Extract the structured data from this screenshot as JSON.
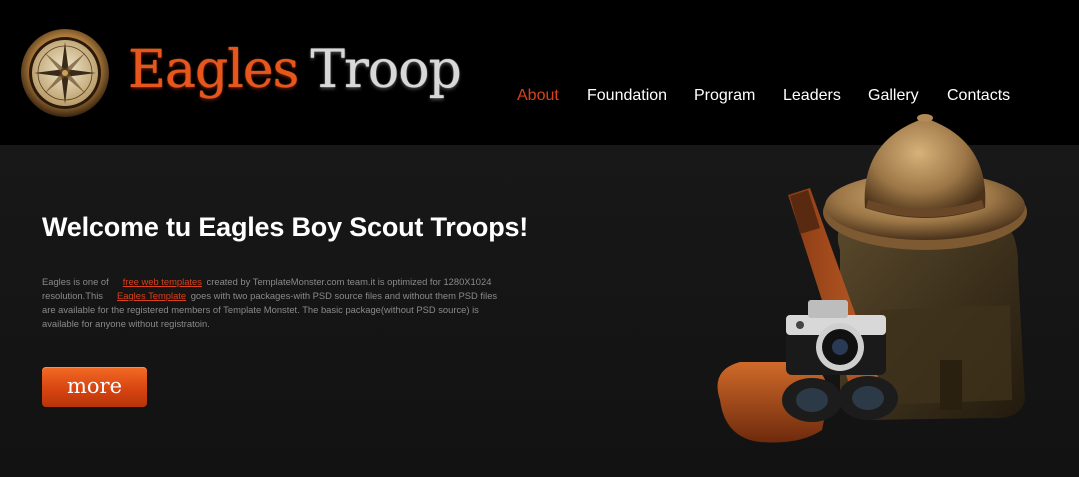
{
  "brand": {
    "name_part1": "Eagles",
    "name_part2": "Troop",
    "icon": "compass-icon"
  },
  "nav": {
    "items": [
      {
        "label": "About",
        "active": true
      },
      {
        "label": "Foundation",
        "active": false
      },
      {
        "label": "Program",
        "active": false
      },
      {
        "label": "Leaders",
        "active": false
      },
      {
        "label": "Gallery",
        "active": false
      },
      {
        "label": "Contacts",
        "active": false
      }
    ]
  },
  "hero": {
    "title": "Welcome tu Eagles Boy Scout Troops!",
    "text_part1": "Eagles is one of",
    "link1": "free web templates",
    "text_part2": "created by TemplateMonster.com team.it is optimized for 1280X1024 resolution.This",
    "link2": "Eagles Template",
    "text_part3": "goes with two packages-with PSD source files and without them PSD files are available for the registered members of Template Monstet. The basic package(without PSD source) is available for anyone without registratoin.",
    "more_label": "more"
  },
  "colors": {
    "accent": "#d9411c",
    "header_bg": "#000000",
    "body_bg": "#151515",
    "button": "#e0531a"
  }
}
